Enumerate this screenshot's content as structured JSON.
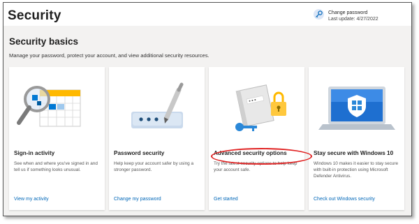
{
  "header": {
    "title": "Security",
    "change_password": {
      "label": "Change password",
      "last_update": "Last update: 4/27/2022",
      "icon": "key-icon"
    }
  },
  "section": {
    "title": "Security basics",
    "description": "Manage your password, protect your account, and view additional security resources."
  },
  "cards": [
    {
      "title": "Sign-in activity",
      "description": "See when and where you've signed in and tell us if something looks unusual.",
      "link": "View my activity",
      "icon": "magnifier-calendar-icon"
    },
    {
      "title": "Password security",
      "description": "Help keep your account safer by using a stronger password.",
      "link": "Change my password",
      "icon": "password-pen-icon"
    },
    {
      "title": "Advanced security options",
      "description": "Try the latest security options to help keep your account safe.",
      "link": "Get started",
      "icon": "notebook-lock-key-icon"
    },
    {
      "title": "Stay secure with Windows 10",
      "description": "Windows 10 makes it easier to stay secure with built-in protection using Microsoft Defender Antivirus.",
      "link": "Check out Windows security",
      "icon": "laptop-shield-icon"
    }
  ],
  "colors": {
    "accent": "#0067b8",
    "highlight": "#e02020",
    "background": "#f3f2f1"
  }
}
